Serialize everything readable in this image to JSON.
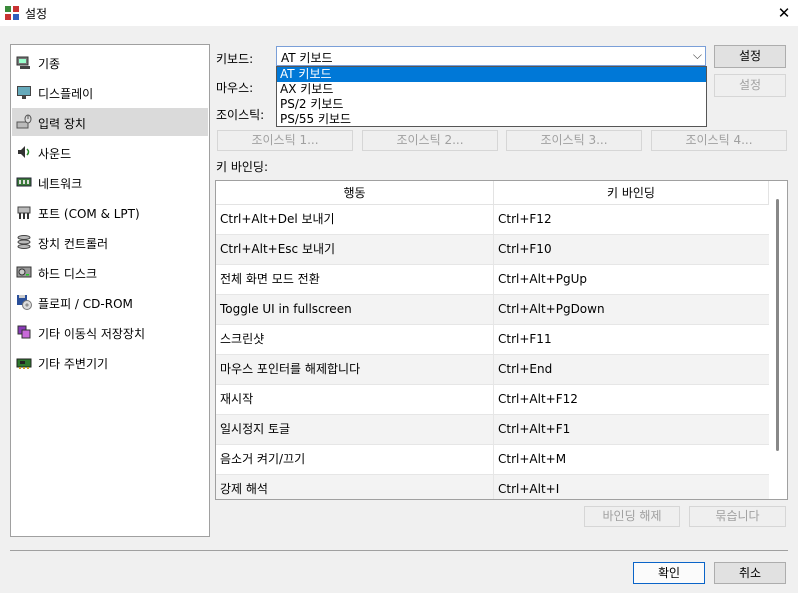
{
  "window": {
    "title": "설정",
    "close_glyph": "✕"
  },
  "nav": {
    "items": [
      {
        "label": "기종",
        "icon": "machine-icon",
        "selected": false
      },
      {
        "label": "디스플레이",
        "icon": "display-icon",
        "selected": false
      },
      {
        "label": "입력 장치",
        "icon": "input-devices-icon",
        "selected": true
      },
      {
        "label": "사운드",
        "icon": "sound-icon",
        "selected": false
      },
      {
        "label": "네트워크",
        "icon": "network-icon",
        "selected": false
      },
      {
        "label": "포트 (COM & LPT)",
        "icon": "ports-icon",
        "selected": false
      },
      {
        "label": "장치 컨트롤러",
        "icon": "storage-controllers-icon",
        "selected": false
      },
      {
        "label": "하드 디스크",
        "icon": "hard-disk-icon",
        "selected": false
      },
      {
        "label": "플로피 / CD-ROM",
        "icon": "floppy-cdrom-icon",
        "selected": false
      },
      {
        "label": "기타 이동식 저장장치",
        "icon": "removable-storage-icon",
        "selected": false
      },
      {
        "label": "기타 주변기기",
        "icon": "peripherals-icon",
        "selected": false
      }
    ]
  },
  "form": {
    "keyboard_label": "키보드:",
    "keyboard_value": "AT 키보드",
    "keyboard_options": [
      "AT 키보드",
      "AX 키보드",
      "PS/2 키보드",
      "PS/55 키보드"
    ],
    "keyboard_settings": "설정",
    "mouse_label": "마우스:",
    "mouse_settings": "설정",
    "joystick_label": "조이스틱:",
    "joystick_buttons": [
      "조이스틱 1...",
      "조이스틱 2...",
      "조이스틱 3...",
      "조이스틱 4..."
    ]
  },
  "bindings": {
    "label": "키 바인딩:",
    "col_action": "행동",
    "col_binding": "키 바인딩",
    "rows": [
      {
        "action": "Ctrl+Alt+Del 보내기",
        "key": "Ctrl+F12"
      },
      {
        "action": "Ctrl+Alt+Esc 보내기",
        "key": "Ctrl+F10"
      },
      {
        "action": "전체 화면 모드 전환",
        "key": "Ctrl+Alt+PgUp"
      },
      {
        "action": "Toggle UI in fullscreen",
        "key": "Ctrl+Alt+PgDown"
      },
      {
        "action": "스크린샷",
        "key": "Ctrl+F11"
      },
      {
        "action": "마우스 포인터를 해제합니다",
        "key": "Ctrl+End"
      },
      {
        "action": "재시작",
        "key": "Ctrl+Alt+F12"
      },
      {
        "action": "일시정지 토글",
        "key": "Ctrl+Alt+F1"
      },
      {
        "action": "음소거 켜기/끄기",
        "key": "Ctrl+Alt+M"
      },
      {
        "action": "강제 해석",
        "key": "Ctrl+Alt+I"
      }
    ],
    "unbind_button": "바인딩 해제",
    "bind_button": "묶습니다"
  },
  "footer": {
    "ok": "확인",
    "cancel": "취소"
  },
  "colors": {
    "selection": "#0078d7",
    "nav_selected": "#dadada",
    "default_button_border": "#0a64c8"
  }
}
